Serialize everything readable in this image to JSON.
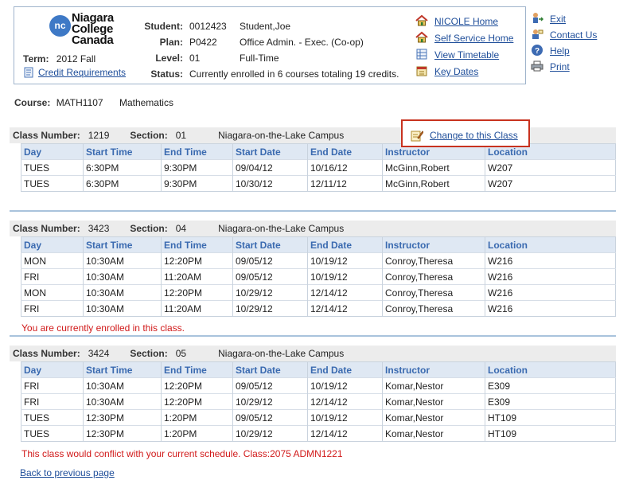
{
  "header": {
    "logo": {
      "badge": "nc",
      "line1": "Niagara",
      "line2": "College",
      "line3": "Canada"
    },
    "term": {
      "label": "Term:",
      "value": "2012 Fall"
    },
    "credit_link": "Credit Requirements",
    "student": {
      "label": "Student:",
      "id": "0012423",
      "name": "Student,Joe"
    },
    "plan": {
      "label": "Plan:",
      "code": "P0422",
      "name": "Office Admin. - Exec. (Co-op)"
    },
    "level": {
      "label": "Level:",
      "code": "01",
      "name": "Full-Time"
    },
    "status": {
      "label": "Status:",
      "value": "Currently enrolled in 6 courses totaling 19 credits."
    },
    "nav_primary": [
      {
        "label": "NICOLE Home",
        "icon": "home-icon"
      },
      {
        "label": "Self Service Home",
        "icon": "home-icon"
      },
      {
        "label": "View Timetable",
        "icon": "timetable-icon"
      },
      {
        "label": "Key Dates",
        "icon": "calendar-icon"
      }
    ],
    "nav_secondary": [
      {
        "label": "Exit",
        "icon": "exit-icon"
      },
      {
        "label": "Contact Us",
        "icon": "contact-icon"
      },
      {
        "label": "Help",
        "icon": "help-icon"
      },
      {
        "label": "Print",
        "icon": "printer-icon"
      }
    ]
  },
  "course": {
    "label": "Course:",
    "code": "MATH1107",
    "title": "Mathematics"
  },
  "columns": [
    "Day",
    "Start Time",
    "End Time",
    "Start Date",
    "End Date",
    "Instructor",
    "Location"
  ],
  "change_link": "Change to this Class",
  "labels": {
    "class_number": "Class Number:",
    "section": "Section:"
  },
  "classes": [
    {
      "number": "1219",
      "section": "01",
      "campus": "Niagara-on-the-Lake Campus",
      "rows": [
        [
          "TUES",
          "6:30PM",
          "9:30PM",
          "09/04/12",
          "10/16/12",
          "McGinn,Robert",
          "W207"
        ],
        [
          "TUES",
          "6:30PM",
          "9:30PM",
          "10/30/12",
          "12/11/12",
          "McGinn,Robert",
          "W207"
        ]
      ],
      "message": ""
    },
    {
      "number": "3423",
      "section": "04",
      "campus": "Niagara-on-the-Lake Campus",
      "rows": [
        [
          "MON",
          "10:30AM",
          "12:20PM",
          "09/05/12",
          "10/19/12",
          "Conroy,Theresa",
          "W216"
        ],
        [
          "FRI",
          "10:30AM",
          "11:20AM",
          "09/05/12",
          "10/19/12",
          "Conroy,Theresa",
          "W216"
        ],
        [
          "MON",
          "10:30AM",
          "12:20PM",
          "10/29/12",
          "12/14/12",
          "Conroy,Theresa",
          "W216"
        ],
        [
          "FRI",
          "10:30AM",
          "11:20AM",
          "10/29/12",
          "12/14/12",
          "Conroy,Theresa",
          "W216"
        ]
      ],
      "message": "You are currently enrolled in this class."
    },
    {
      "number": "3424",
      "section": "05",
      "campus": "Niagara-on-the-Lake Campus",
      "rows": [
        [
          "FRI",
          "10:30AM",
          "12:20PM",
          "09/05/12",
          "10/19/12",
          "Komar,Nestor",
          "E309"
        ],
        [
          "FRI",
          "10:30AM",
          "12:20PM",
          "10/29/12",
          "12/14/12",
          "Komar,Nestor",
          "E309"
        ],
        [
          "TUES",
          "12:30PM",
          "1:20PM",
          "09/05/12",
          "10/19/12",
          "Komar,Nestor",
          "HT109"
        ],
        [
          "TUES",
          "12:30PM",
          "1:20PM",
          "10/29/12",
          "12/14/12",
          "Komar,Nestor",
          "HT109"
        ]
      ],
      "message": "This class would conflict with your current schedule. Class:2075 ADMN1221"
    }
  ],
  "back_link": "Back to previous page",
  "colors": {
    "link": "#1f4e9a",
    "header_text": "#3a6ab0",
    "error": "#d11a1a",
    "highlight_border": "#c8321f"
  }
}
